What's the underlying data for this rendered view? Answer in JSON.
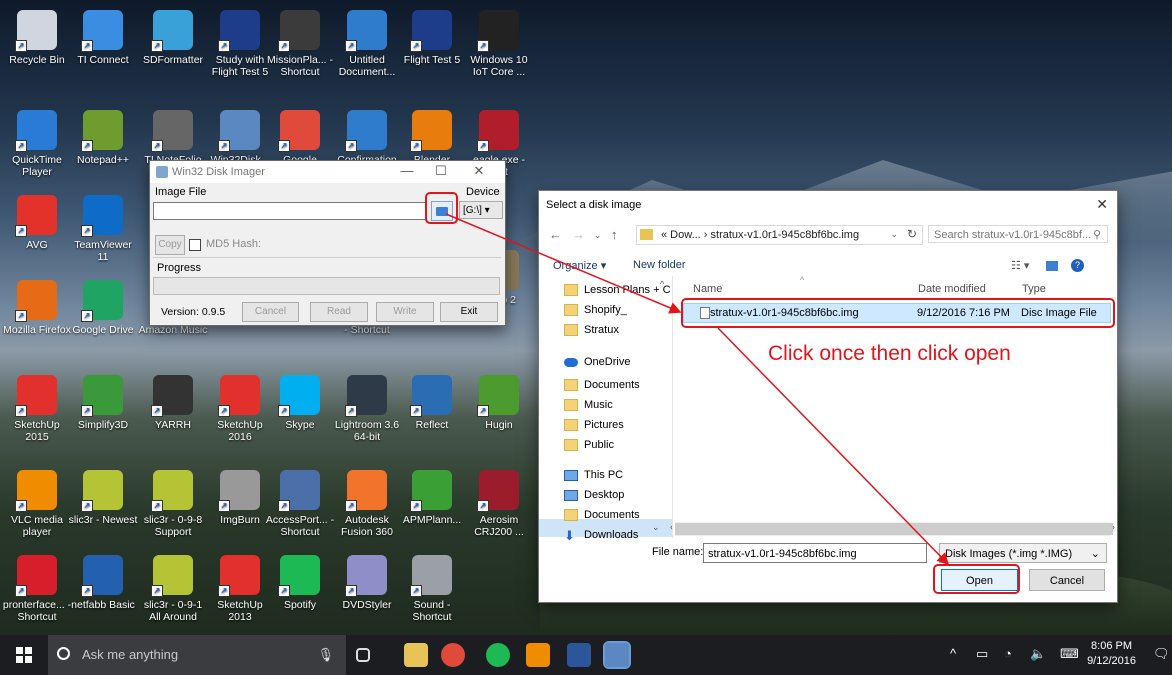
{
  "desktop": {
    "icons": [
      {
        "label": "Recycle Bin",
        "color": "#cfd6df"
      },
      {
        "label": "TI Connect",
        "color": "#3a8de0"
      },
      {
        "label": "SDFormatter",
        "color": "#3aa0d8"
      },
      {
        "label": "Study with Flight Test 5",
        "color": "#1d3d8a"
      },
      {
        "label": "MissionPla... - Shortcut",
        "color": "#3b3b3b"
      },
      {
        "label": "Untitled Document...",
        "color": "#2f7ccd"
      },
      {
        "label": "Flight Test 5",
        "color": "#1d3d8a"
      },
      {
        "label": "Windows 10 IoT Core ...",
        "color": "#222"
      },
      {
        "label": "QuickTime Player",
        "color": "#2a7bd6"
      },
      {
        "label": "Notepad++",
        "color": "#6f9c2f"
      },
      {
        "label": "TI NoteFolio",
        "color": "#666"
      },
      {
        "label": "Win32Disk...",
        "color": "#5b88c1"
      },
      {
        "label": "Google",
        "color": "#e04a3a"
      },
      {
        "label": "Confirmation",
        "color": "#2f7ccd"
      },
      {
        "label": "Blender",
        "color": "#e87d0d"
      },
      {
        "label": "eagle.exe - ...ut",
        "color": "#b11d2b"
      },
      {
        "label": "AVG",
        "color": "#e2322a"
      },
      {
        "label": "TeamViewer 11",
        "color": "#0e6bc7"
      },
      {
        "label": "Mozilla Firefox",
        "color": "#e66b16"
      },
      {
        "label": "Google Drive",
        "color": "#1fa463"
      },
      {
        "label": "Amazon Music",
        "color": "#ffffff"
      },
      {
        "label": "- Shortcut",
        "color": "#555"
      },
      {
        "label": "Gimp 2",
        "color": "#8a7a5a"
      },
      {
        "label": "SketchUp 2015",
        "color": "#e2312c"
      },
      {
        "label": "Simplify3D",
        "color": "#3a9a3a"
      },
      {
        "label": "YARRH",
        "color": "#333"
      },
      {
        "label": "SketchUp 2016",
        "color": "#e2312c"
      },
      {
        "label": "Skype",
        "color": "#00aff0"
      },
      {
        "label": "Lightroom 3.6 64-bit",
        "color": "#2e3a47"
      },
      {
        "label": "Reflect",
        "color": "#2a6db3"
      },
      {
        "label": "Hugin",
        "color": "#4d9a2f"
      },
      {
        "label": "VLC media player",
        "color": "#f08c00"
      },
      {
        "label": "slic3r - Newest",
        "color": "#b5c435"
      },
      {
        "label": "slic3r - 0-9-8 Support",
        "color": "#b5c435"
      },
      {
        "label": "ImgBurn",
        "color": "#999"
      },
      {
        "label": "AccessPort... - Shortcut",
        "color": "#4b6fa8"
      },
      {
        "label": "Autodesk Fusion 360",
        "color": "#f2742a"
      },
      {
        "label": "APMPlann...",
        "color": "#3aa036"
      },
      {
        "label": "Aerosim CRJ200 ...",
        "color": "#9b1c2a"
      },
      {
        "label": "pronterface... - Shortcut",
        "color": "#d81e2a"
      },
      {
        "label": "netfabb Basic",
        "color": "#2460b0"
      },
      {
        "label": "slic3r - 0-9-1 All Around",
        "color": "#b5c435"
      },
      {
        "label": "SketchUp 2013",
        "color": "#e2312c"
      },
      {
        "label": "Spotify",
        "color": "#1db954"
      },
      {
        "label": "DVDStyler",
        "color": "#8e8ec8"
      },
      {
        "label": "Sound - Shortcut",
        "color": "#9aa0a6"
      }
    ]
  },
  "imager": {
    "title": "Win32 Disk Imager",
    "image_file_label": "Image File",
    "device_label": "Device",
    "device_value": "[G:\\]",
    "copy_label": "Copy",
    "md5_label": "MD5 Hash:",
    "progress_label": "Progress",
    "version": "Version: 0.9.5",
    "cancel": "Cancel",
    "read": "Read",
    "write": "Write",
    "exit": "Exit"
  },
  "dialog": {
    "title": "Select a disk image",
    "address": "« Dow... › stratux-v1.0r1-945c8bf6bc.img",
    "search_placeholder": "Search stratux-v1.0r1-945c8bf...",
    "organize": "Organize ▾",
    "new_folder": "New folder",
    "nav_items": [
      {
        "label": "Lesson Plans + C",
        "type": "folder"
      },
      {
        "label": "Shopify_",
        "type": "folder"
      },
      {
        "label": "Stratux",
        "type": "folder"
      },
      {
        "label": "OneDrive",
        "type": "cloud"
      },
      {
        "label": "Documents",
        "type": "folder"
      },
      {
        "label": "Music",
        "type": "folder"
      },
      {
        "label": "Pictures",
        "type": "folder"
      },
      {
        "label": "Public",
        "type": "folder"
      },
      {
        "label": "This PC",
        "type": "pc"
      },
      {
        "label": "Desktop",
        "type": "pc"
      },
      {
        "label": "Documents",
        "type": "folder"
      },
      {
        "label": "Downloads",
        "type": "download"
      }
    ],
    "columns": {
      "name": "Name",
      "date": "Date modified",
      "type": "Type"
    },
    "file": {
      "name": "stratux-v1.0r1-945c8bf6bc.img",
      "date": "9/12/2016 7:16 PM",
      "type": "Disc Image File"
    },
    "file_name_label": "File name:",
    "file_name_value": "stratux-v1.0r1-945c8bf6bc.img",
    "file_type": "Disk Images (*.img *.IMG)",
    "open": "Open",
    "cancel": "Cancel"
  },
  "annotation": {
    "text": "Click once then click open",
    "color": "#e3141b"
  },
  "taskbar": {
    "search_placeholder": "Ask me anything",
    "time": "8:06 PM",
    "date": "9/12/2016"
  }
}
